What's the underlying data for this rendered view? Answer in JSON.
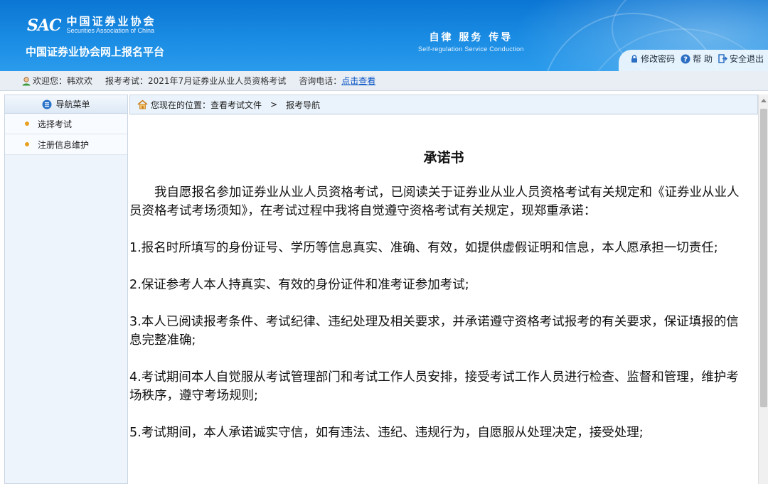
{
  "header": {
    "logo_abbr": "SAC",
    "logo_cn": "中国证券业协会",
    "logo_en": "Securities Association of China",
    "platform_title": "中国证券业协会网上报名平台",
    "slogan_cn": "自律  服务  传导",
    "slogan_en": "Self-regulation  Service  Conduction",
    "links": {
      "change_password": "修改密码",
      "help": "帮 助",
      "logout": "安全退出"
    }
  },
  "info_bar": {
    "welcome": "欢迎您：韩欢欢",
    "exam": "报考考试：2021年7月证券业从业人员资格考试",
    "phone_label": "咨询电话：",
    "phone_link": "点击查看"
  },
  "sidebar": {
    "title": "导航菜单",
    "items": [
      {
        "label": "选择考试"
      },
      {
        "label": "注册信息维护"
      }
    ]
  },
  "breadcrumb": {
    "prefix": "您现在的位置：查看考试文件",
    "arrow": ">",
    "current": "报考导航"
  },
  "document": {
    "title": "承诺书",
    "paragraphs": [
      "我自愿报名参加证券业从业人员资格考试，已阅读关于证券业从业人员资格考试有关规定和《证券业从业人员资格考试考场须知》，在考试过程中我将自觉遵守资格考试有关规定，现郑重承诺：",
      "1.报名时所填写的身份证号、学历等信息真实、准确、有效，如提供虚假证明和信息，本人愿承担一切责任;",
      "2.保证参考人本人持真实、有效的身份证件和准考证参加考试;",
      "3.本人已阅读报考条件、考试纪律、违纪处理及相关要求，并承诺遵守资格考试报考的有关要求，保证填报的信息完整准确;",
      "4.考试期间本人自觉服从考试管理部门和考试工作人员安排，接受考试工作人员进行检查、监督和管理，维护考场秩序，遵守考场规则;",
      "5.考试期间，本人承诺诚实守信，如有违法、违纪、违规行为，自愿服从处理决定，接受处理;"
    ]
  },
  "colors": {
    "header_blue": "#1a8ce3",
    "link_blue": "#0b56c4",
    "bullet_orange": "#e8a020"
  }
}
